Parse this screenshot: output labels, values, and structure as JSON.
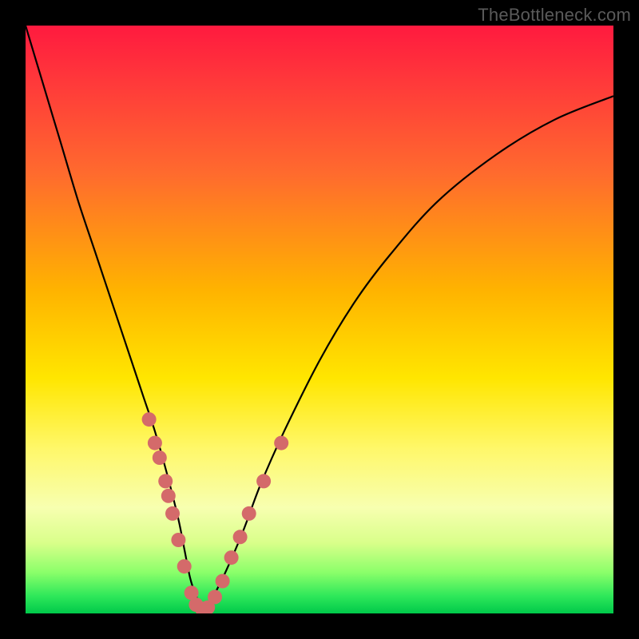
{
  "watermark": "TheBottleneck.com",
  "colors": {
    "background": "#000000",
    "curve": "#000000",
    "dot": "#d46a6a",
    "gradient_top": "#ff1a3f",
    "gradient_bottom": "#00c94a"
  },
  "chart_data": {
    "type": "line",
    "title": "",
    "xlabel": "",
    "ylabel": "",
    "xlim": [
      0,
      100
    ],
    "ylim": [
      0,
      100
    ],
    "note": "Axes are implicit (no tick labels shown). x is horizontal position across the plot (0=left, 100=right); y is vertical with 0 at bottom (green) and 100 at top (red).",
    "series": [
      {
        "name": "bottleneck-curve",
        "x": [
          0,
          3,
          6,
          9,
          12,
          15,
          18,
          20,
          22,
          24,
          26,
          27,
          28,
          29,
          30,
          31,
          32,
          34,
          37,
          40,
          44,
          50,
          56,
          62,
          70,
          80,
          90,
          100
        ],
        "y": [
          100,
          90,
          80,
          70,
          61,
          52,
          43,
          37,
          31,
          24,
          16,
          11,
          6,
          3,
          1,
          1,
          3,
          7,
          14,
          22,
          31,
          43,
          53,
          61,
          70,
          78,
          84,
          88
        ]
      }
    ],
    "points": {
      "name": "highlighted-samples",
      "note": "Pink dots clustered along the lower V of the curve.",
      "coords": [
        {
          "x": 21.0,
          "y": 33.0
        },
        {
          "x": 22.0,
          "y": 29.0
        },
        {
          "x": 22.8,
          "y": 26.5
        },
        {
          "x": 23.8,
          "y": 22.5
        },
        {
          "x": 24.3,
          "y": 20.0
        },
        {
          "x": 25.0,
          "y": 17.0
        },
        {
          "x": 26.0,
          "y": 12.5
        },
        {
          "x": 27.0,
          "y": 8.0
        },
        {
          "x": 28.2,
          "y": 3.5
        },
        {
          "x": 29.0,
          "y": 1.5
        },
        {
          "x": 30.0,
          "y": 0.8
        },
        {
          "x": 31.0,
          "y": 1.0
        },
        {
          "x": 32.2,
          "y": 2.8
        },
        {
          "x": 33.5,
          "y": 5.5
        },
        {
          "x": 35.0,
          "y": 9.5
        },
        {
          "x": 36.5,
          "y": 13.0
        },
        {
          "x": 38.0,
          "y": 17.0
        },
        {
          "x": 40.5,
          "y": 22.5
        },
        {
          "x": 43.5,
          "y": 29.0
        }
      ]
    }
  }
}
